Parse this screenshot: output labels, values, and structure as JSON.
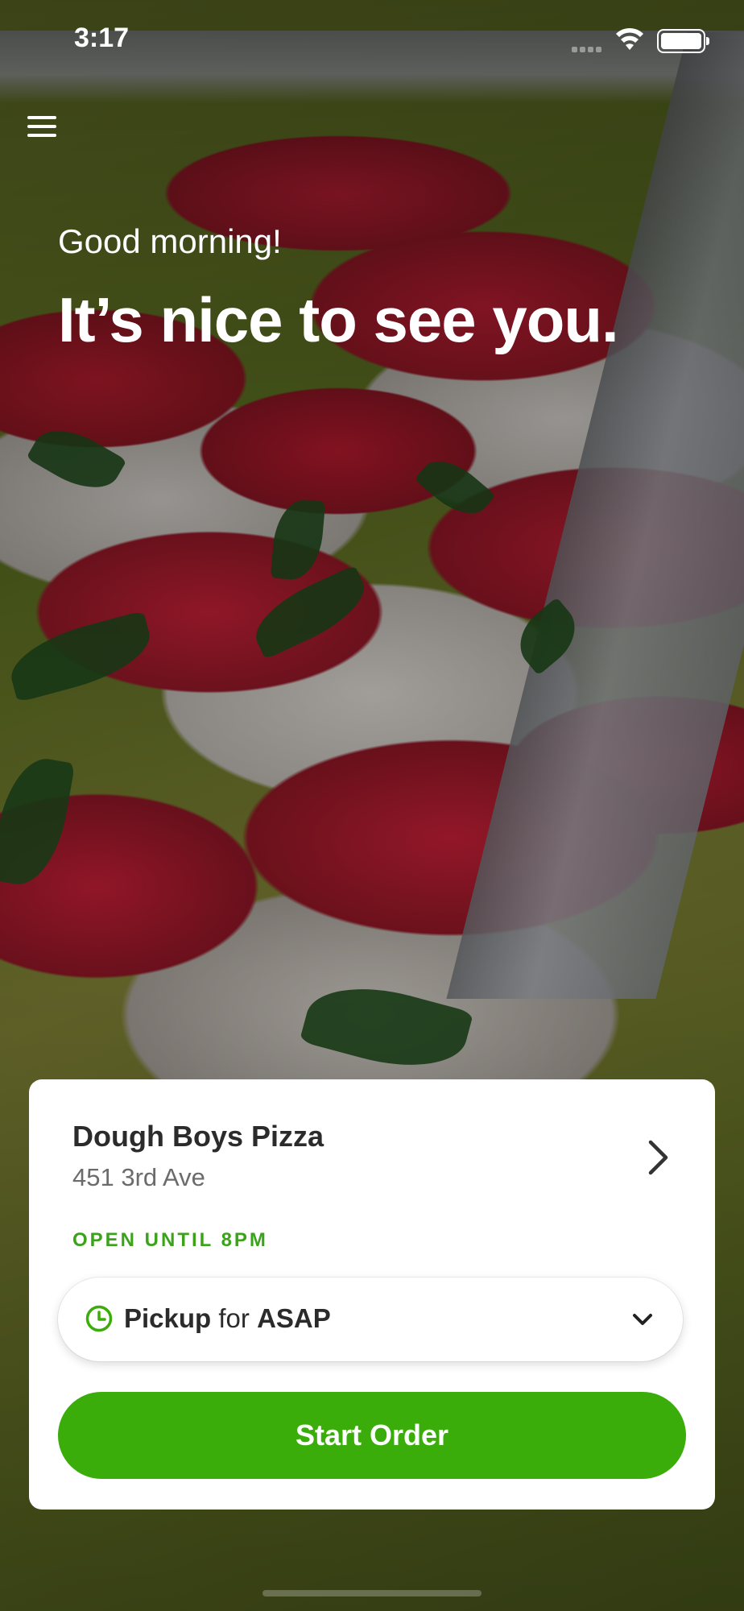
{
  "status_bar": {
    "time": "3:17"
  },
  "header": {
    "greeting": "Good morning!",
    "headline": "It’s nice to see you."
  },
  "store_card": {
    "name": "Dough Boys Pizza",
    "address": "451 3rd Ave",
    "hours": "OPEN UNTIL 8PM",
    "order_mode": {
      "mode": "Pickup",
      "connector": "for",
      "time": "ASAP"
    },
    "start_button": "Start Order"
  },
  "colors": {
    "accent_green": "#3aad0a",
    "open_text_green": "#3aa31a",
    "card_bg": "#ffffff"
  },
  "icons": [
    "menu-icon",
    "wifi-icon",
    "battery-icon",
    "chevron-right-icon",
    "clock-icon",
    "chevron-down-icon"
  ]
}
